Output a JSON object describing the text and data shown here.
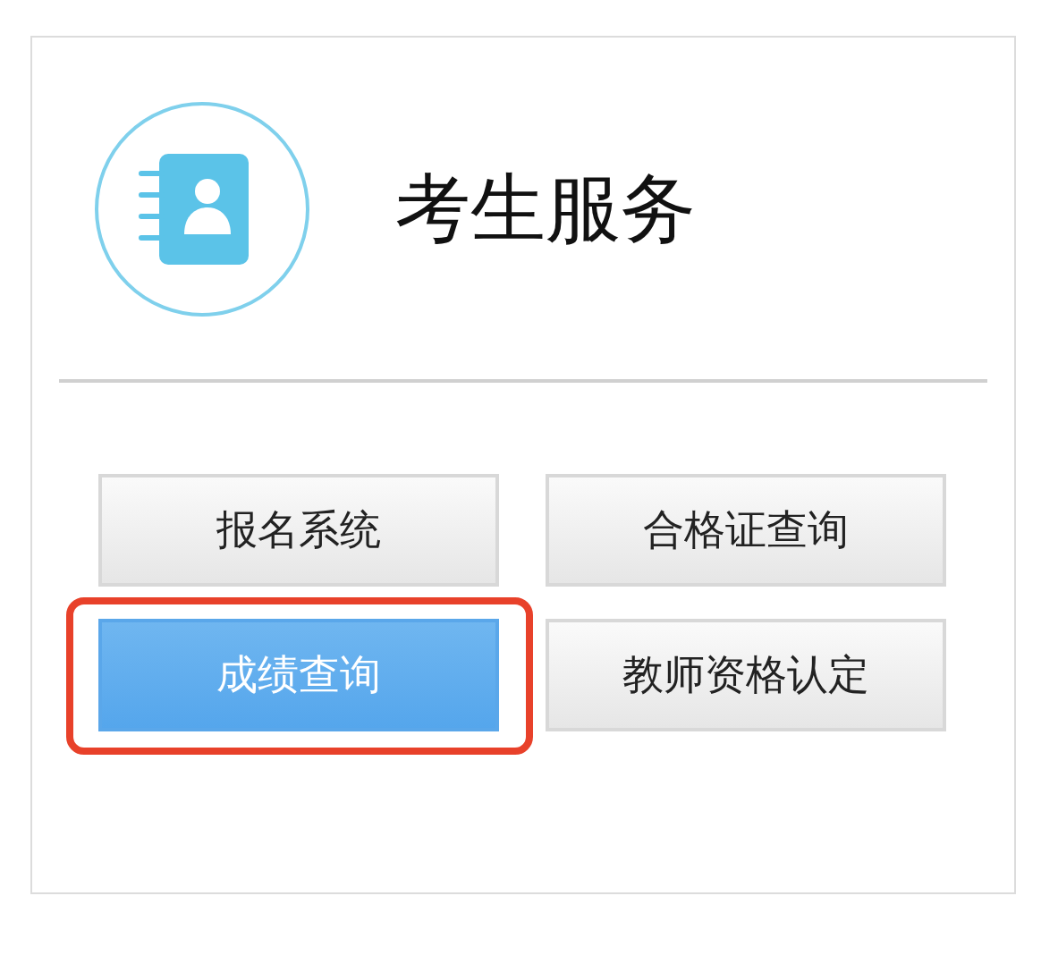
{
  "title": "考生服务",
  "buttons": [
    {
      "label": "报名系统",
      "selected": false,
      "highlighted": false
    },
    {
      "label": "合格证查询",
      "selected": false,
      "highlighted": false
    },
    {
      "label": "成绩查询",
      "selected": true,
      "highlighted": true
    },
    {
      "label": "教师资格认定",
      "selected": false,
      "highlighted": false
    }
  ]
}
